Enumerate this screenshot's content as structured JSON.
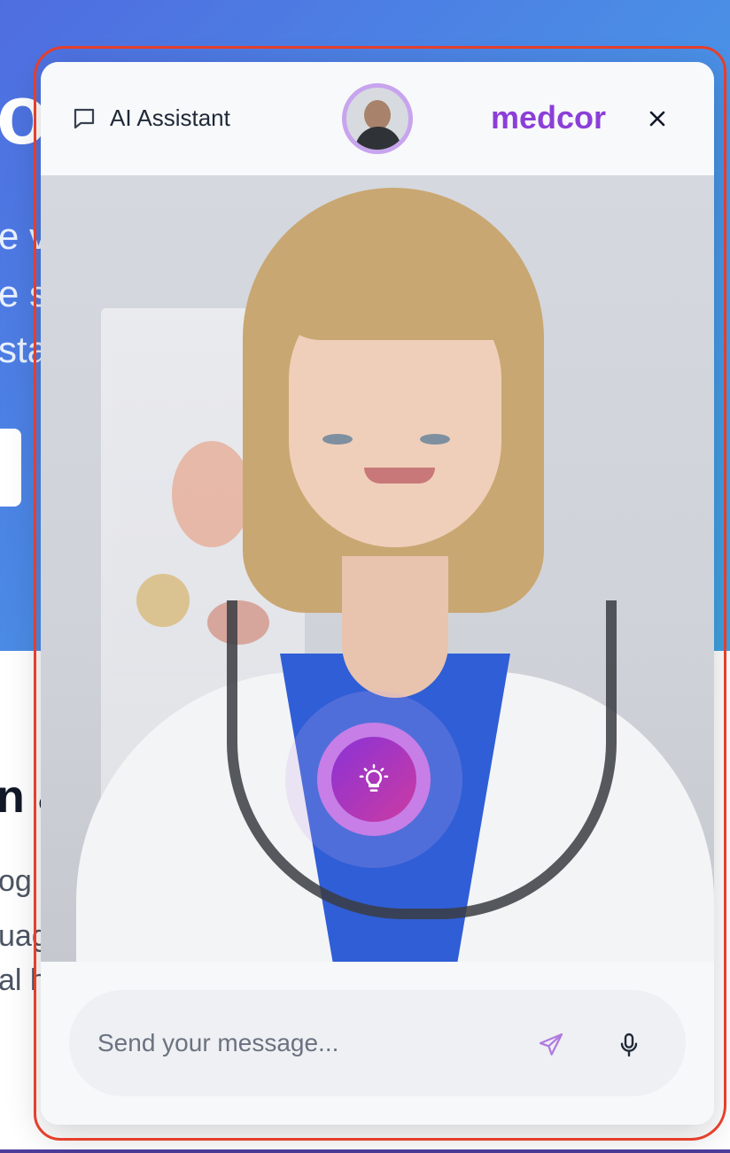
{
  "background_page": {
    "hero_title_fragment": "o",
    "hero_text_lines": [
      "e v",
      "e s",
      "sta"
    ],
    "section_title_fragment": "n &",
    "section_text_lines": [
      "og",
      "uag",
      "al h"
    ]
  },
  "widget": {
    "header": {
      "title": "AI Assistant",
      "brand": "medcor",
      "chat_icon": "chat-bubble-icon",
      "close_icon": "close-icon"
    },
    "avatar": {
      "label": "user-avatar"
    },
    "hint_button": {
      "icon": "lightbulb-icon"
    },
    "caption": {
      "text": ""
    },
    "composer": {
      "placeholder": "Send your message...",
      "value": "",
      "send_icon": "send-icon",
      "mic_icon": "microphone-icon"
    }
  },
  "colors": {
    "brand": "#8b3fd8",
    "hero_gradient_start": "#4f6de0",
    "hero_gradient_end": "#3fa2e0",
    "annotation_outline": "#e53f2b",
    "hint_gradient_start": "#8a32d6",
    "hint_gradient_end": "#cc3ba2"
  }
}
